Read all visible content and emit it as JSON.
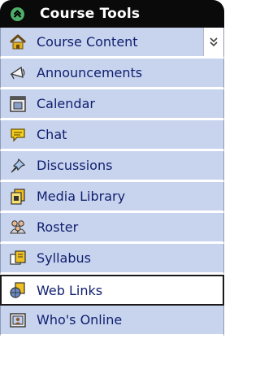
{
  "header": {
    "title": "Course Tools",
    "toggle_icon": "collapse-up-icon"
  },
  "menu": {
    "items": [
      {
        "label": "Course Content",
        "icon": "home-icon"
      },
      {
        "label": "Announcements",
        "icon": "megaphone-icon"
      },
      {
        "label": "Calendar",
        "icon": "calendar-icon"
      },
      {
        "label": "Chat",
        "icon": "chat-bubble-icon"
      },
      {
        "label": "Discussions",
        "icon": "pushpin-icon"
      },
      {
        "label": "Media Library",
        "icon": "media-library-icon"
      },
      {
        "label": "Roster",
        "icon": "people-icon"
      },
      {
        "label": "Syllabus",
        "icon": "syllabus-icon"
      },
      {
        "label": "Web Links",
        "icon": "web-links-icon"
      },
      {
        "label": "Who's Online",
        "icon": "whos-online-icon"
      }
    ],
    "selected": "Web Links"
  },
  "colors": {
    "header_bg": "#0a0a0a",
    "item_bg": "#c8d4ee",
    "label_text": "#0f1e6e",
    "toggle_green": "#4fae6a"
  }
}
